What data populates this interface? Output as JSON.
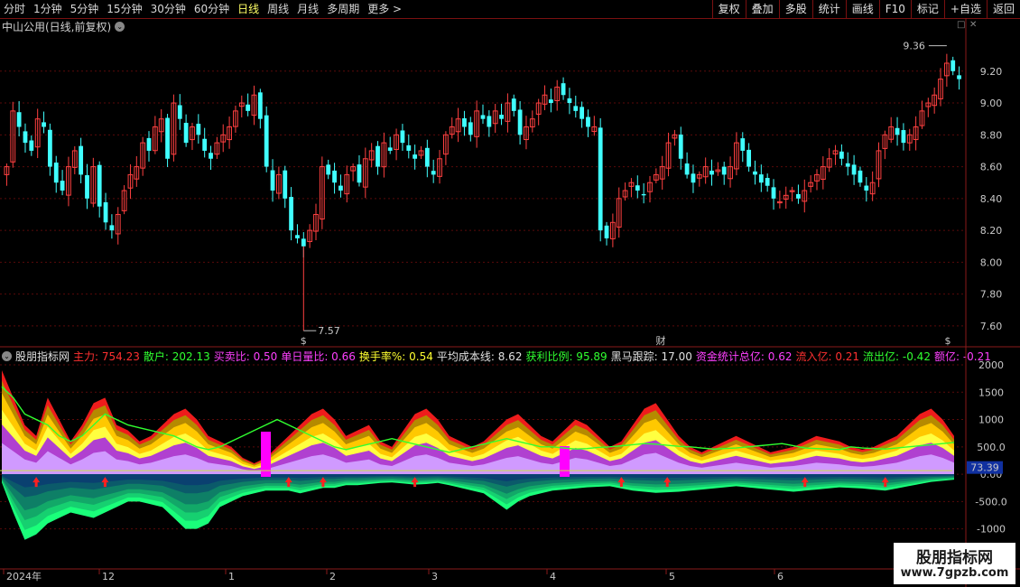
{
  "toolbar": {
    "periods": [
      "分时",
      "1分钟",
      "5分钟",
      "15分钟",
      "30分钟",
      "60分钟",
      "日线",
      "周线",
      "月线",
      "多周期",
      "更多 >"
    ],
    "active_period": "日线",
    "actions": [
      "复权",
      "叠加",
      "多股",
      "统计",
      "画线",
      "F10",
      "标记",
      "+自选",
      "返回"
    ]
  },
  "main_title": "中山公用(日线,前复权)",
  "main_title_btn": "⌄",
  "indicator": {
    "name": "股朋指标网",
    "items": [
      {
        "label": "主力: 754.23",
        "color": "#ff3030"
      },
      {
        "label": "散户: 202.13",
        "color": "#30ff30"
      },
      {
        "label": "买卖比: 0.50",
        "color": "#ff40ff"
      },
      {
        "label": "单日量比: 0.66",
        "color": "#ff40ff"
      },
      {
        "label": "换手率%: 0.54",
        "color": "#ffff30"
      },
      {
        "label": "平均成本线: 8.62",
        "color": "#e0e0e0"
      },
      {
        "label": "获利比例: 95.89",
        "color": "#30ff30"
      },
      {
        "label": "黑马跟踪: 17.00",
        "color": "#e0e0e0"
      },
      {
        "label": "资金统计总亿: 0.62",
        "color": "#ff40ff"
      },
      {
        "label": "流入亿: 0.21",
        "color": "#ff3030"
      },
      {
        "label": "流出亿: -0.42",
        "color": "#30ff30"
      },
      {
        "label": "额亿: -0.21",
        "color": "#ff40ff"
      }
    ]
  },
  "watermark": {
    "line1": "股朋指标网",
    "line2": "www.7gpzb.com"
  },
  "chart_data": [
    {
      "type": "candlestick",
      "y_ticks": [
        "9.20",
        "9.00",
        "8.80",
        "8.60",
        "8.40",
        "8.20",
        "8.00",
        "7.80",
        "7.60"
      ],
      "ylim": [
        7.52,
        9.42
      ],
      "annotations": {
        "high": "9.36",
        "low": "7.57",
        "event": "财",
        "dollar_mark": "$"
      },
      "closes": [
        8.6,
        8.95,
        8.85,
        8.75,
        8.7,
        8.9,
        8.85,
        8.6,
        8.5,
        8.45,
        8.6,
        8.7,
        8.55,
        8.4,
        8.6,
        8.35,
        8.25,
        8.2,
        8.3,
        8.45,
        8.55,
        8.6,
        8.75,
        8.7,
        8.85,
        8.9,
        8.65,
        9.0,
        8.9,
        8.75,
        8.85,
        8.8,
        8.7,
        8.65,
        8.75,
        8.8,
        8.85,
        8.95,
        9.0,
        8.95,
        9.05,
        8.9,
        8.6,
        8.45,
        8.55,
        8.4,
        8.2,
        8.15,
        8.1,
        8.2,
        8.3,
        8.6,
        8.55,
        8.5,
        8.45,
        8.55,
        8.6,
        8.5,
        8.65,
        8.7,
        8.6,
        8.75,
        8.7,
        8.8,
        8.75,
        8.7,
        8.65,
        8.7,
        8.6,
        8.55,
        8.65,
        8.8,
        8.85,
        8.9,
        8.85,
        8.8,
        8.95,
        8.9,
        8.85,
        8.95,
        8.9,
        9.0,
        8.95,
        8.8,
        8.85,
        8.9,
        9.0,
        9.05,
        9.0,
        9.1,
        9.05,
        9.0,
        8.95,
        8.9,
        8.85,
        8.85,
        8.2,
        8.15,
        8.25,
        8.4,
        8.45,
        8.5,
        8.45,
        8.42,
        8.5,
        8.55,
        8.6,
        8.75,
        8.8,
        8.65,
        8.55,
        8.5,
        8.55,
        8.6,
        8.55,
        8.58,
        8.55,
        8.6,
        8.75,
        8.7,
        8.6,
        8.55,
        8.5,
        8.48,
        8.4,
        8.38,
        8.42,
        8.45,
        8.4,
        8.45,
        8.5,
        8.55,
        8.6,
        8.65,
        8.7,
        8.65,
        8.6,
        8.55,
        8.5,
        8.45,
        8.5,
        8.7,
        8.8,
        8.85,
        8.8,
        8.75,
        8.8,
        8.85,
        8.95,
        9.0,
        9.05,
        9.15,
        9.25,
        9.2,
        9.15
      ],
      "x_labels": [
        "2024年",
        "12",
        "1",
        "2",
        "3",
        "4",
        "5",
        "6"
      ]
    },
    {
      "type": "area",
      "y_ticks": [
        "2000",
        "1500",
        "1000",
        "500.0",
        "0.00",
        "-500.0",
        "-1000"
      ],
      "ylim": [
        -1600,
        2000
      ],
      "last_value_label": "73.39",
      "series": [
        {
          "values": [
            1900,
            1400,
            900,
            700,
            1400,
            1000,
            600,
            900,
            1300,
            1400,
            900,
            800,
            600,
            700,
            900,
            1100,
            1200,
            1000,
            700,
            600,
            500,
            300,
            200,
            300,
            500,
            700,
            900,
            1100,
            1200,
            1000,
            700,
            800,
            900,
            600,
            500,
            800,
            1100,
            1200,
            1000,
            700,
            600,
            500,
            600,
            800,
            1000,
            1100,
            900,
            700,
            600,
            800,
            1000,
            900,
            700,
            500,
            600,
            900,
            1200,
            1300,
            1000,
            700,
            500,
            400,
            500,
            600,
            700,
            600,
            500,
            400,
            450,
            500,
            600,
            700,
            650,
            600,
            500,
            450,
            500,
            600,
            700,
            900,
            1100,
            1200,
            1000,
            700
          ]
        },
        {
          "values": [
            -150,
            -700,
            -1200,
            -1100,
            -900,
            -800,
            -700,
            -750,
            -800,
            -700,
            -600,
            -500,
            -500,
            -550,
            -600,
            -800,
            -1000,
            -1000,
            -900,
            -600,
            -500,
            -400,
            -350,
            -300,
            -300,
            -300,
            -350,
            -300,
            -250,
            -250,
            -200,
            -200,
            -180,
            -160,
            -150,
            -170,
            -190,
            -180,
            -160,
            -200,
            -250,
            -300,
            -350,
            -500,
            -650,
            -500,
            -400,
            -350,
            -300,
            -280,
            -260,
            -240,
            -230,
            -220,
            -260,
            -300,
            -320,
            -340,
            -330,
            -320,
            -300,
            -280,
            -260,
            -240,
            -220,
            -240,
            -260,
            -280,
            -300,
            -320,
            -300,
            -280,
            -260,
            -240,
            -250,
            -260,
            -280,
            -300,
            -260,
            -220,
            -180,
            -140,
            -120,
            -100
          ]
        },
        {
          "values": [
            1600,
            1400,
            1100,
            1000,
            900,
            700,
            600,
            700,
            900,
            1100,
            1000,
            900,
            850,
            800,
            750,
            700,
            600,
            500,
            450,
            500,
            600,
            700,
            800,
            900,
            1000,
            900,
            800,
            700,
            600,
            500,
            450,
            500,
            550,
            600,
            650,
            600,
            550,
            500,
            450,
            400,
            450,
            500,
            550,
            600,
            650,
            600,
            550,
            500,
            500,
            480,
            460,
            470,
            490,
            500,
            520,
            540,
            560,
            550,
            530,
            510,
            500,
            480,
            460,
            470,
            480,
            500,
            520,
            540,
            560,
            520,
            480,
            470,
            460,
            450,
            500,
            480,
            470,
            460,
            480,
            500,
            520,
            540,
            560,
            580
          ]
        }
      ],
      "signal_arrows_at": [
        3,
        9,
        25,
        28,
        36,
        54,
        58,
        70,
        77
      ]
    }
  ]
}
